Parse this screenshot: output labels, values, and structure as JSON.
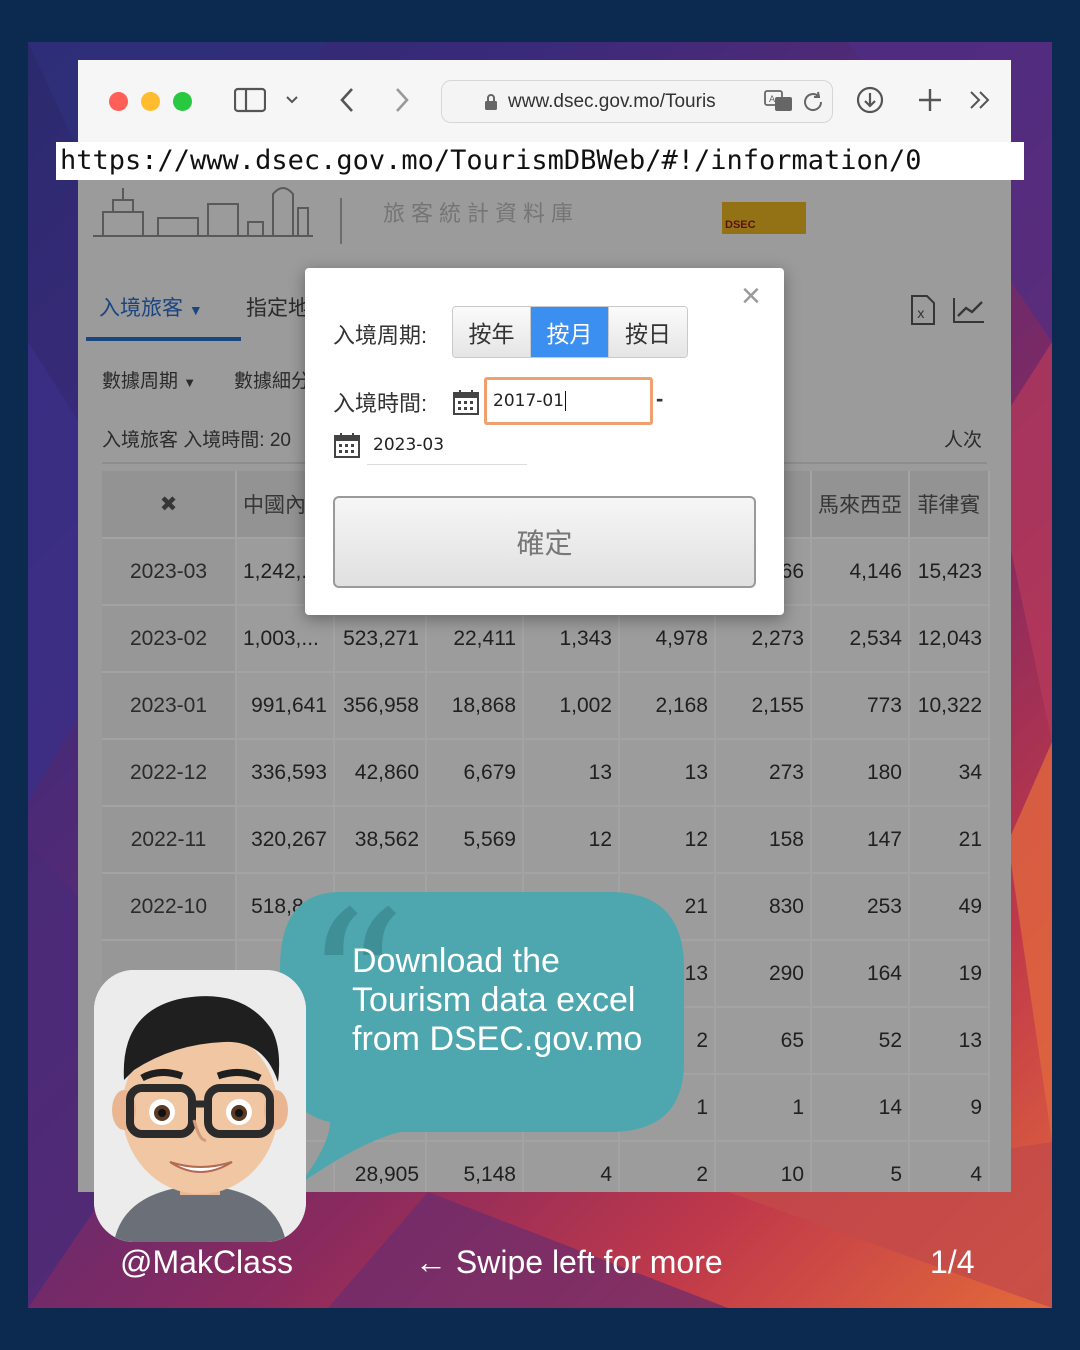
{
  "browser": {
    "address": "www.dsec.gov.mo/Touris",
    "url_banner": "https://www.dsec.gov.mo/TourismDBWeb/#!/information/0"
  },
  "site": {
    "title": "旅客統計資料庫",
    "logo_text": "DSEC",
    "nav": [
      "入境旅客",
      "指定地"
    ],
    "subnav": [
      "數據周期",
      "數據細分"
    ],
    "caption": "入境旅客 入境時間: 20",
    "unit": "人次"
  },
  "table": {
    "headers": [
      "✖",
      "中國內",
      "",
      "",
      "",
      "",
      "",
      "馬來西亞",
      "菲律賓"
    ],
    "rows": [
      [
        "2023-03",
        "1,242,...",
        "",
        "",
        "",
        "",
        "…66",
        "4,146",
        "15,423"
      ],
      [
        "2023-02",
        "1,003,...",
        "523,271",
        "22,411",
        "1,343",
        "4,978",
        "2,273",
        "2,534",
        "12,043"
      ],
      [
        "2023-01",
        "991,641",
        "356,958",
        "18,868",
        "1,002",
        "2,168",
        "2,155",
        "773",
        "10,322"
      ],
      [
        "2022-12",
        "336,593",
        "42,860",
        "6,679",
        "13",
        "13",
        "273",
        "180",
        "34"
      ],
      [
        "2022-11",
        "320,267",
        "38,562",
        "5,569",
        "12",
        "12",
        "158",
        "147",
        "21"
      ],
      [
        "2022-10",
        "518,843",
        "",
        "",
        "",
        "21",
        "830",
        "253",
        "49"
      ],
      [
        "",
        "",
        "",
        "",
        "",
        "13",
        "290",
        "164",
        "19"
      ],
      [
        "",
        "",
        "",
        "",
        "",
        "2",
        "65",
        "52",
        "13"
      ],
      [
        "",
        "",
        "",
        "",
        "",
        "1",
        "1",
        "14",
        "9"
      ],
      [
        "",
        "",
        "28,905",
        "5,148",
        "4",
        "2",
        "10",
        "5",
        "4"
      ]
    ]
  },
  "modal": {
    "period_label": "入境周期:",
    "segments": [
      "按年",
      "按月",
      "按日"
    ],
    "active_segment": "按月",
    "time_label": "入境時間:",
    "start_value": "2017-01",
    "separator": "-",
    "end_value": "2023-03",
    "confirm_label": "確定",
    "close_symbol": "×"
  },
  "bubble": {
    "text": "Download the Tourism data excel from DSEC.gov.mo"
  },
  "footer": {
    "handle": "@MakClass",
    "swipe": "← Swipe left for more",
    "page": "1/4"
  },
  "colors": {
    "frame": "#0c2a4f",
    "accent_blue": "#3b8ff0",
    "bubble": "#4ea7ae",
    "focus_border": "#f0a06e"
  }
}
